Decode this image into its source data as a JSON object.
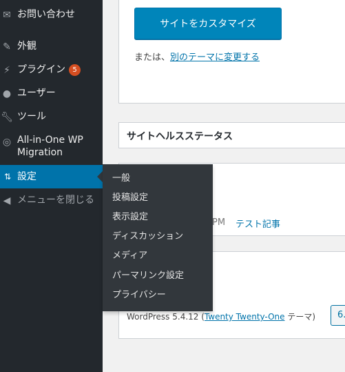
{
  "sidebar": {
    "items": [
      {
        "label": "お問い合わせ",
        "icon": "mail-icon"
      },
      {
        "label": "外観",
        "icon": "paintbrush-icon"
      },
      {
        "label": "プラグイン",
        "icon": "plugin-icon",
        "badge": "5"
      },
      {
        "label": "ユーザー",
        "icon": "user-icon"
      },
      {
        "label": "ツール",
        "icon": "wrench-icon"
      },
      {
        "label": "All-in-One WP Migration",
        "icon": "migration-icon"
      },
      {
        "label": "設定",
        "icon": "settings-icon"
      },
      {
        "label": "メニューを閉じる",
        "icon": "collapse-icon"
      }
    ]
  },
  "flyout": {
    "items": [
      "一般",
      "投稿設定",
      "表示設定",
      "ディスカッション",
      "メディア",
      "パーマリンク設定",
      "プライバシー"
    ]
  },
  "main": {
    "customize_button": "サイトをカスタマイズ",
    "or_text": "または、",
    "change_theme_link": "別のテーマに変更する",
    "health_title": "サイトヘルスステータス",
    "partial_pm": "PM",
    "test_post_link": "テスト記事",
    "wp_version_text": "WordPress 5.4.12 (",
    "theme_link": "Twenty Twenty-One",
    "theme_suffix": " テーマ)",
    "partial_button": "6."
  },
  "colors": {
    "sidebar_bg": "#23282d",
    "active_bg": "#0073aa",
    "flyout_bg": "#32373c",
    "button_bg": "#0085ba",
    "badge_bg": "#d54e21"
  }
}
